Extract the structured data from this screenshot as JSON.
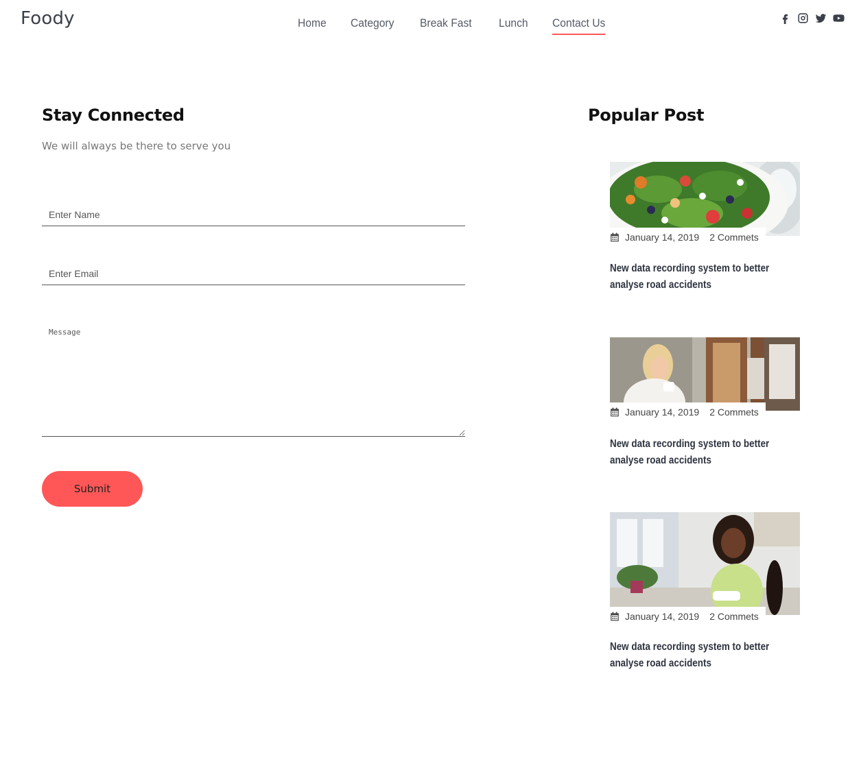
{
  "brand": "Foody",
  "nav": [
    {
      "label": "Home",
      "active": false
    },
    {
      "label": "Category",
      "active": false
    },
    {
      "label": "Break Fast",
      "active": false
    },
    {
      "label": "Lunch",
      "active": false
    },
    {
      "label": "Contact Us",
      "active": true
    }
  ],
  "social": [
    "facebook-icon",
    "instagram-icon",
    "twitter-icon",
    "youtube-icon"
  ],
  "contact": {
    "title": "Stay Connected",
    "subtitle": "We will always be there to serve you",
    "name_placeholder": "Enter Name",
    "email_placeholder": "Enter Email",
    "message_placeholder": "Message",
    "submit_label": "Submit"
  },
  "popular": {
    "title": "Popular Post",
    "posts": [
      {
        "date": "January 14, 2019",
        "comments": "2 Commets",
        "title": "New data recording system to better analyse road accidents",
        "image": "salad-bowl"
      },
      {
        "date": "January 14, 2019",
        "comments": "2 Commets",
        "title": "New data recording system to better analyse road accidents",
        "image": "woman-drinking-coffee"
      },
      {
        "date": "January 14, 2019",
        "comments": "2 Commets",
        "title": "New data recording system to better analyse road accidents",
        "image": "woman-eating-in-kitchen"
      }
    ]
  },
  "colors": {
    "accent": "#ff5757",
    "text_dark": "#2e3440"
  }
}
